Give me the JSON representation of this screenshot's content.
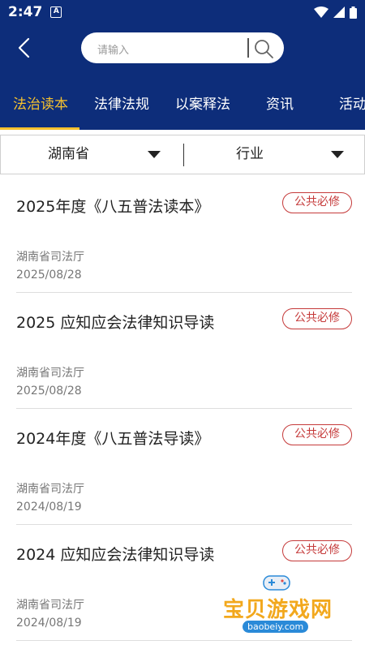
{
  "status_bar": {
    "time": "2:47",
    "notification_glyph": "A"
  },
  "search": {
    "placeholder": "请输入"
  },
  "tabs": [
    {
      "label": "法治读本",
      "active": true
    },
    {
      "label": "法律法规",
      "active": false
    },
    {
      "label": "以案释法",
      "active": false
    },
    {
      "label": "资讯",
      "active": false
    },
    {
      "label": "活动",
      "active": false
    }
  ],
  "filters": {
    "region": "湖南省",
    "category": "行业"
  },
  "articles": [
    {
      "title": "2025年度《八五普法读本》",
      "badge": "公共必修",
      "source": "湖南省司法厅",
      "date": "2025/08/28"
    },
    {
      "title": "2025 应知应会法律知识导读",
      "badge": "公共必修",
      "source": "湖南省司法厅",
      "date": "2025/08/28"
    },
    {
      "title": "2024年度《八五普法导读》",
      "badge": "公共必修",
      "source": "湖南省司法厅",
      "date": "2024/08/19"
    },
    {
      "title": "2024 应知应会法律知识导读",
      "badge": "公共必修",
      "source": "湖南省司法厅",
      "date": "2024/08/19"
    }
  ],
  "watermark": {
    "text": "宝贝游戏网",
    "url": "baobeiy.com"
  },
  "colors": {
    "primary": "#0d2d7a",
    "accent": "#f5c12e",
    "badge": "#c53a3a"
  }
}
